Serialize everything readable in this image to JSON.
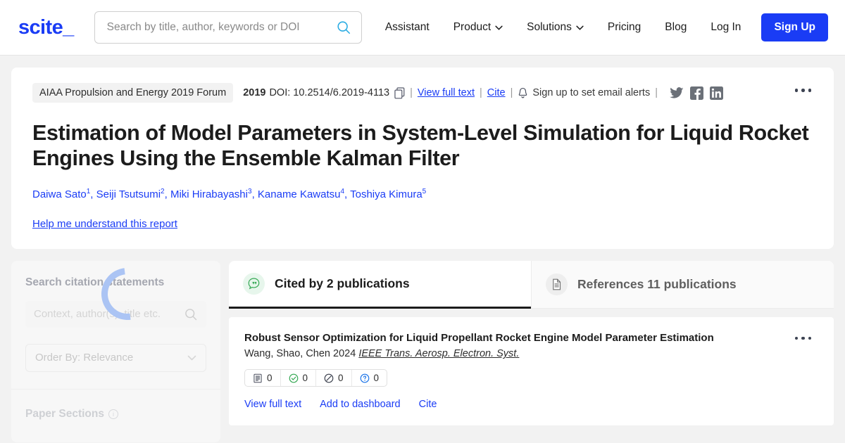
{
  "header": {
    "logo_text": "scite",
    "logo_underscore": "_",
    "search_placeholder": "Search by title, author, keywords or DOI",
    "search_value": "",
    "nav": [
      {
        "label": "Assistant",
        "has_caret": false
      },
      {
        "label": "Product",
        "has_caret": true
      },
      {
        "label": "Solutions",
        "has_caret": true
      },
      {
        "label": "Pricing",
        "has_caret": false
      },
      {
        "label": "Blog",
        "has_caret": false
      },
      {
        "label": "Log In",
        "has_caret": false
      }
    ],
    "signup_label": "Sign Up"
  },
  "paper": {
    "journal_badge": "AIAA Propulsion and Energy 2019 Forum",
    "year": "2019",
    "doi": "DOI: 10.2514/6.2019-4113",
    "view_full_text": "View full text",
    "cite": "Cite",
    "alerts": "Sign up to set email alerts",
    "separator": "|",
    "title": "Estimation of Model Parameters in System-Level Simulation for Liquid Rocket Engines Using the Ensemble Kalman Filter",
    "authors": [
      {
        "name": "Daiwa Sato",
        "affiliation": "1"
      },
      {
        "name": "Seiji Tsutsumi",
        "affiliation": "2"
      },
      {
        "name": "Miki Hirabayashi",
        "affiliation": "3"
      },
      {
        "name": "Kaname Kawatsu",
        "affiliation": "4"
      },
      {
        "name": "Toshiya Kimura",
        "affiliation": "5"
      }
    ],
    "help_link": "Help me understand this report"
  },
  "sidebar": {
    "title": "Search citation statements",
    "search_placeholder": "Context, author(s), title etc.",
    "search_value": "",
    "order_by": "Order By: Relevance",
    "paper_sections": "Paper Sections"
  },
  "tabs": [
    {
      "label": "Cited by 2 publications",
      "icon": "quote-bubble-icon",
      "active": true
    },
    {
      "label": "References 11 publications",
      "icon": "document-icon",
      "active": false
    }
  ],
  "results": [
    {
      "title": "Robust Sensor Optimization for Liquid Propellant Rocket Engine Model Parameter Estimation",
      "authors": "Wang, Shao, Chen",
      "year": "2024",
      "journal": "IEEE Trans. Aerosp. Electron. Syst.",
      "badges": [
        {
          "icon": "document-icon",
          "count": "0"
        },
        {
          "icon": "supporting-check-icon",
          "count": "0"
        },
        {
          "icon": "contrasting-slash-icon",
          "count": "0"
        },
        {
          "icon": "mentioning-question-icon",
          "count": "0"
        }
      ],
      "actions": [
        "View full text",
        "Add to dashboard",
        "Cite"
      ]
    }
  ],
  "colors": {
    "brand_blue": "#1a3cf5",
    "search_icon_blue": "#29abe2",
    "spinner_blue": "#4a86f7",
    "supporting_green": "#34a853",
    "mentioning_blue": "#1a73e8",
    "page_background": "#f2f2f2"
  }
}
